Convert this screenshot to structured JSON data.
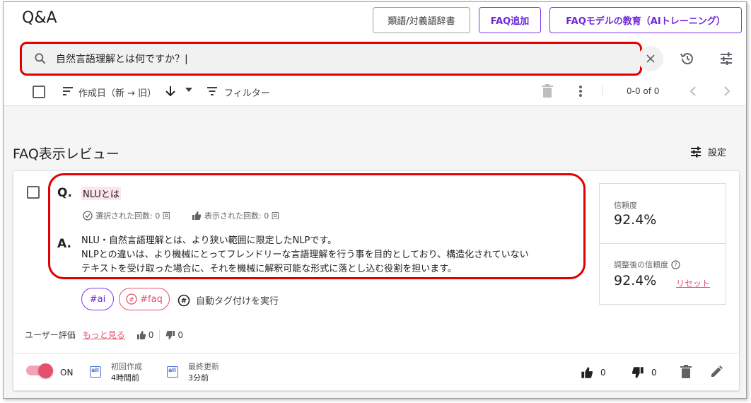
{
  "header": {
    "title": "Q&A",
    "buttons": {
      "dictionary": "類語/対義語辞書",
      "add_faq": "FAQ追加",
      "train": "FAQモデルの教育（AIトレーニング）"
    }
  },
  "search": {
    "value": "自然言語理解とは何ですか？|"
  },
  "toolbar": {
    "sort_label": "作成日（新 → 旧）",
    "filter_label": "フィルター",
    "pager": "0-0 of 0"
  },
  "section": {
    "title": "FAQ表示レビュー",
    "settings_label": "設定"
  },
  "faq_item": {
    "q_label": "Q.",
    "question": "NLUとは",
    "selected_count": "選択された回数: 0 回",
    "displayed_count": "表示された回数: 0 回",
    "a_label": "A.",
    "answer_lines": [
      "NLU・自然言語理解とは、より狭い範囲に限定したNLPです。",
      "NLPとの違いは、より機械にとってフレンドリーな言語理解を行う事を目的としており、構造化されていない",
      "テキストを受け取った場合に、それを機械に解釈可能な形式に落とし込む役割を担います。"
    ],
    "tags": [
      "#ai",
      "#faq"
    ],
    "autotag_label": "自動タグ付けを実行",
    "confidence": {
      "label": "信頼度",
      "value": "92.4%",
      "adjusted_label": "調整後の信頼度",
      "adjusted_value": "92.4%",
      "reset_label": "リセット"
    },
    "rating": {
      "label": "ユーザー評価",
      "more_link": "もっと見る",
      "up": "0",
      "down": "0"
    },
    "footer": {
      "toggle_label": "ON",
      "toggle_on": true,
      "created_label": "初回作成",
      "created_value": "4時間前",
      "updated_label": "最終更新",
      "updated_value": "3分前",
      "up_count": "0",
      "down_count": "0"
    }
  },
  "colors": {
    "accent_purple": "#6d28d9",
    "accent_pink": "#e5506a",
    "highlight_red": "#e00000"
  }
}
